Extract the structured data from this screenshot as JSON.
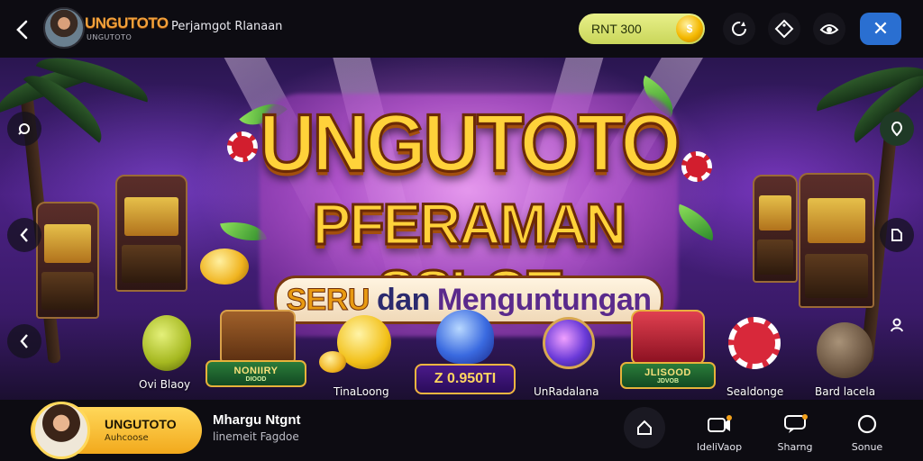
{
  "header": {
    "brand_title": "UNGUTOTO",
    "brand_subtitle": "UNGUTOTO",
    "page_subtitle": "Perjamgot Rlanaan",
    "balance": "RNT 300",
    "coin_symbol": "$",
    "close_symbol": "✕",
    "back_symbol": "‹"
  },
  "hero": {
    "logo_line1": "UNGUTOTO",
    "logo_line2": "PFERAMAN SSLOT",
    "logo_line3_a": "SERU",
    "logo_line3_b": "dan",
    "logo_line3_c": "Menguntungan",
    "games": [
      {
        "label": "Ovi Blaoy"
      },
      {
        "plaque_top": "NONIIRY",
        "plaque_bottom": "DIOOD"
      },
      {
        "label": "TinaLoong"
      },
      {
        "amount": "Z 0.950TI"
      },
      {
        "label": "UnRadalana"
      },
      {
        "plaque_top": "JLISOOD",
        "plaque_bottom": "JDVOB"
      },
      {
        "label": "Sealdonge"
      },
      {
        "label": "Bard lacela"
      }
    ]
  },
  "footer": {
    "profile_name": "UNGUTOTO",
    "profile_sub": "Auhcoose",
    "promo_title": "Mhargu Ntgnt",
    "promo_sub": "linemeit Fagdoe",
    "nav": [
      {
        "label": "IdeliVaop"
      },
      {
        "label": "Sharng"
      },
      {
        "label": "Sonue"
      }
    ]
  }
}
